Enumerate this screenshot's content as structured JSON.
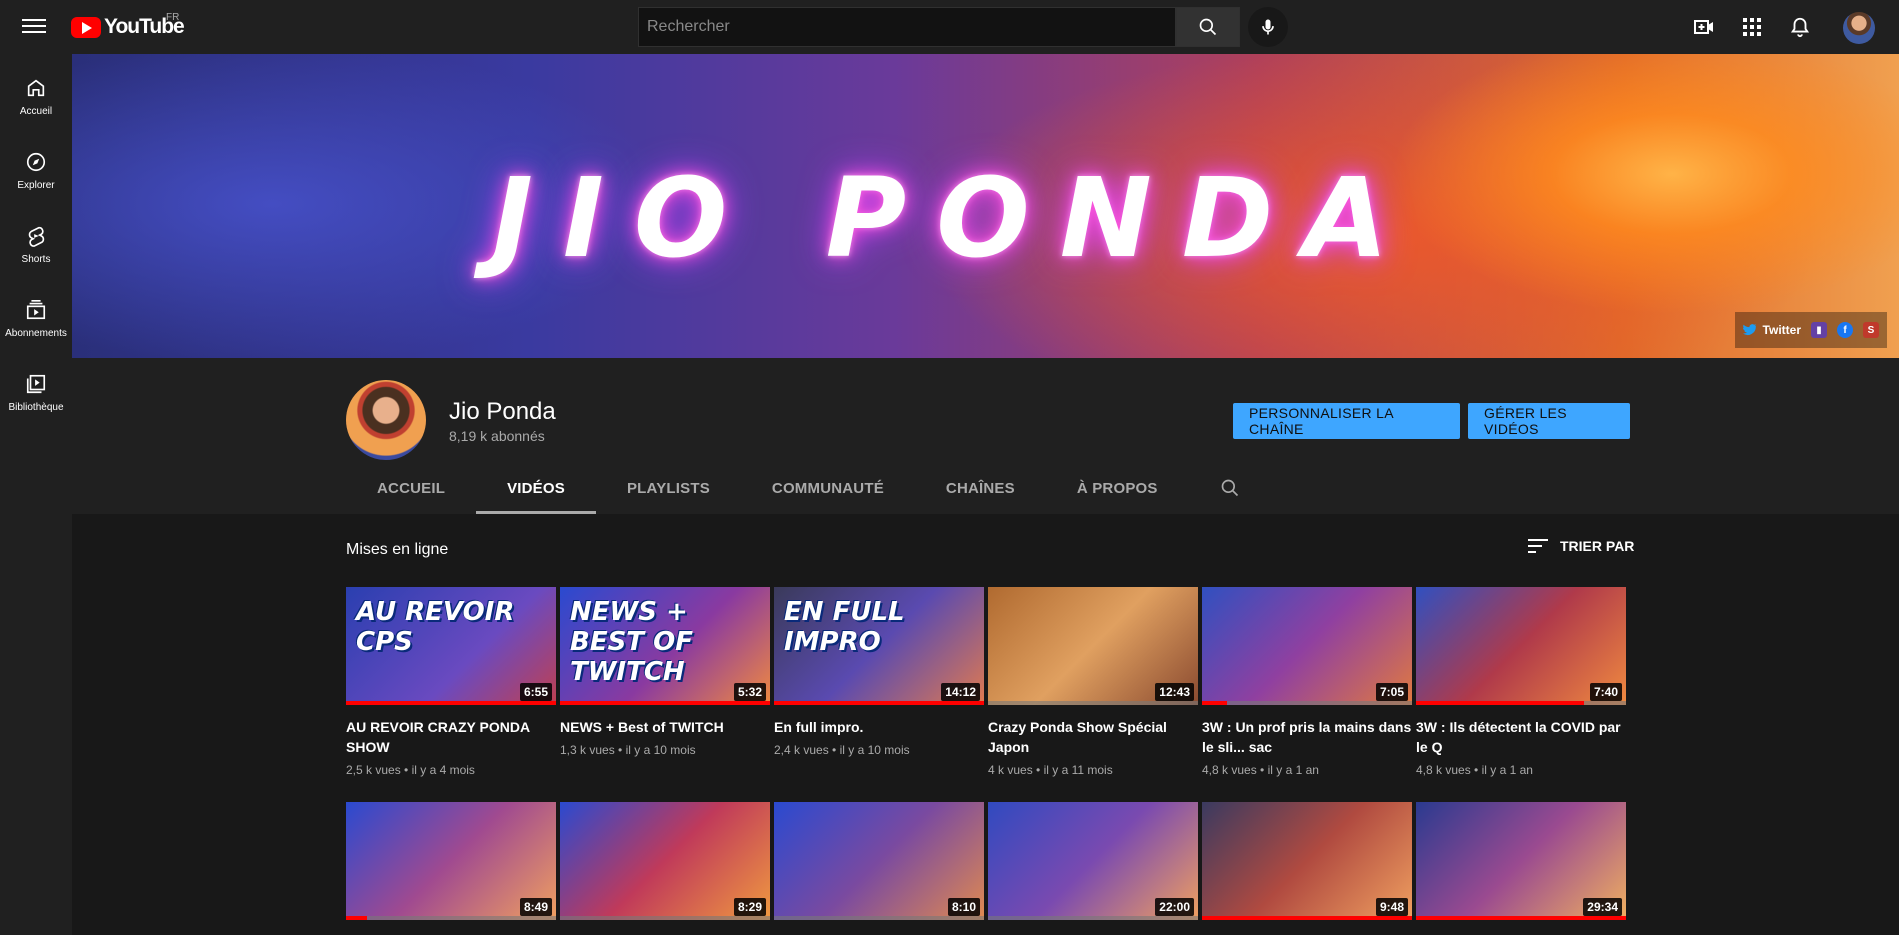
{
  "header": {
    "logo_text": "YouTube",
    "country": "FR",
    "search_placeholder": "Rechercher"
  },
  "sidebar": {
    "items": [
      {
        "label": "Accueil",
        "icon": "home-icon"
      },
      {
        "label": "Explorer",
        "icon": "compass-icon"
      },
      {
        "label": "Shorts",
        "icon": "shorts-icon"
      },
      {
        "label": "Abonnements",
        "icon": "subscriptions-icon"
      },
      {
        "label": "Bibliothèque",
        "icon": "library-icon"
      }
    ]
  },
  "banner": {
    "title": "JIO PONDA",
    "links": {
      "twitter": "Twitter"
    }
  },
  "channel": {
    "name": "Jio Ponda",
    "subscribers": "8,19 k abonnés",
    "customize_button": "PERSONNALISER LA CHAÎNE",
    "manage_button": "GÉRER LES VIDÉOS",
    "tabs": [
      "ACCUEIL",
      "VIDÉOS",
      "PLAYLISTS",
      "COMMUNAUTÉ",
      "CHAÎNES",
      "À PROPOS"
    ],
    "active_tab": "VIDÉOS"
  },
  "content": {
    "section_title": "Mises en ligne",
    "sort_label": "TRIER PAR",
    "videos": [
      {
        "title": "AU REVOIR CRAZY PONDA SHOW",
        "views": "2,5 k vues",
        "age": "il y a 4 mois",
        "duration": "6:55",
        "thumb_text": "AU REVOIR CPS",
        "watched": 1.0
      },
      {
        "title": "NEWS + Best of TWITCH",
        "views": "1,3 k vues",
        "age": "il y a 10 mois",
        "duration": "5:32",
        "thumb_text": "NEWS + BEST OF TWITCH",
        "watched": 1.0
      },
      {
        "title": "En full impro.",
        "views": "2,4 k vues",
        "age": "il y a 10 mois",
        "duration": "14:12",
        "thumb_text": "EN FULL IMPRO",
        "watched": 1.0
      },
      {
        "title": "Crazy Ponda Show Spécial Japon",
        "views": "4 k vues",
        "age": "il y a 11 mois",
        "duration": "12:43",
        "thumb_text": "",
        "watched": 0.0
      },
      {
        "title": "3W : Un prof pris la mains dans le sli... sac",
        "views": "4,8 k vues",
        "age": "il y a 1 an",
        "duration": "7:05",
        "thumb_text": "",
        "watched": 0.12
      },
      {
        "title": "3W : Ils détectent la COVID par le Q",
        "views": "4,8 k vues",
        "age": "il y a 1 an",
        "duration": "7:40",
        "thumb_text": "",
        "watched": 0.8
      },
      {
        "title": "",
        "views": "",
        "age": "",
        "duration": "8:49",
        "thumb_text": "",
        "watched": 0.1
      },
      {
        "title": "",
        "views": "",
        "age": "",
        "duration": "8:29",
        "thumb_text": "",
        "watched": 0.0
      },
      {
        "title": "",
        "views": "",
        "age": "",
        "duration": "8:10",
        "thumb_text": "",
        "watched": 0.0
      },
      {
        "title": "",
        "views": "",
        "age": "",
        "duration": "22:00",
        "thumb_text": "",
        "watched": 0.0
      },
      {
        "title": "",
        "views": "",
        "age": "",
        "duration": "9:48",
        "thumb_text": "",
        "watched": 1.0
      },
      {
        "title": "",
        "views": "",
        "age": "",
        "duration": "29:34",
        "thumb_text": "",
        "watched": 1.0
      }
    ]
  },
  "colors": {
    "accent_blue": "#3ea6ff",
    "brand_red": "#ff0000",
    "bg_dark": "#181818",
    "bar_dark": "#202020"
  }
}
